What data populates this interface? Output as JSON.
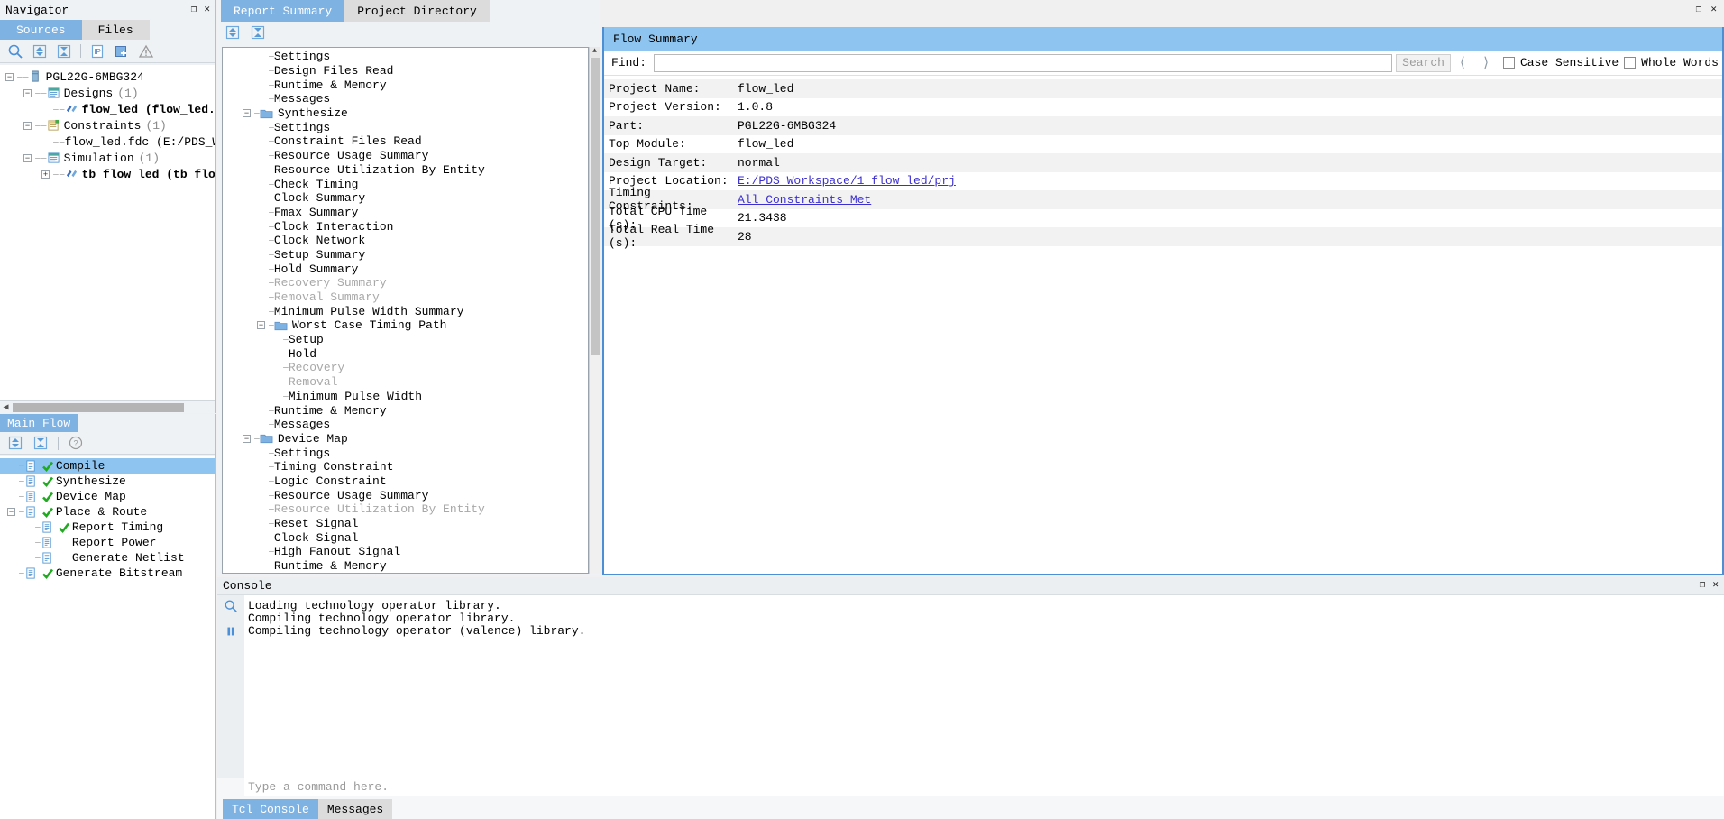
{
  "navigator": {
    "title": "Navigator",
    "tabs": [
      {
        "label": "Sources",
        "active": true
      },
      {
        "label": "Files",
        "active": false
      }
    ],
    "toolbar": [
      {
        "name": "search-icon"
      },
      {
        "name": "expand-all-icon"
      },
      {
        "name": "collapse-all-icon"
      },
      {
        "name": "ip-icon"
      },
      {
        "name": "add-file-icon"
      },
      {
        "name": "warning-icon"
      }
    ],
    "tree": [
      {
        "label": "PGL22G-6MBG324",
        "count": "",
        "indent": 0,
        "toggle": "minus",
        "icon": "device-icon"
      },
      {
        "label": "Designs",
        "count": "(1)",
        "indent": 1,
        "toggle": "minus",
        "icon": "folder-doc-icon"
      },
      {
        "label": "flow_led (flow_led.v)",
        "count": "",
        "indent": 2,
        "toggle": "none",
        "icon": "verilog-icon",
        "bold": true
      },
      {
        "label": "Constraints",
        "count": "(1)",
        "indent": 1,
        "toggle": "minus",
        "icon": "constraint-icon"
      },
      {
        "label": "flow_led.fdc (E:/PDS_Wo:",
        "count": "",
        "indent": 2,
        "toggle": "none",
        "icon": "none"
      },
      {
        "label": "Simulation",
        "count": "(1)",
        "indent": 1,
        "toggle": "minus",
        "icon": "folder-doc-icon"
      },
      {
        "label": "tb_flow_led (tb_flow_",
        "count": "",
        "indent": 2,
        "toggle": "plus",
        "icon": "verilog-icon",
        "bold": true
      }
    ]
  },
  "main_flow": {
    "tab_label": "Main_Flow",
    "toolbar": [
      {
        "name": "expand-all-icon"
      },
      {
        "name": "collapse-all-icon"
      },
      {
        "name": "help-icon"
      }
    ],
    "items": [
      {
        "label": "Compile",
        "done": true,
        "indent": 0,
        "toggle": "none",
        "selected": true
      },
      {
        "label": "Synthesize",
        "done": true,
        "indent": 0,
        "toggle": "none",
        "selected": false
      },
      {
        "label": "Device Map",
        "done": true,
        "indent": 0,
        "toggle": "none",
        "selected": false
      },
      {
        "label": "Place & Route",
        "done": true,
        "indent": 0,
        "toggle": "minus",
        "selected": false
      },
      {
        "label": "Report Timing",
        "done": true,
        "indent": 1,
        "toggle": "none",
        "selected": false
      },
      {
        "label": "Report Power",
        "done": false,
        "indent": 1,
        "toggle": "none",
        "selected": false
      },
      {
        "label": "Generate Netlist",
        "done": false,
        "indent": 1,
        "toggle": "none",
        "selected": false
      },
      {
        "label": "Generate Bitstream",
        "done": true,
        "indent": 0,
        "toggle": "none",
        "selected": false
      }
    ]
  },
  "center": {
    "tabs": [
      {
        "label": "Report Summary",
        "active": true
      },
      {
        "label": "Project Directory",
        "active": false
      }
    ],
    "toolbar": [
      {
        "name": "expand-all-icon"
      },
      {
        "name": "collapse-all-icon"
      }
    ],
    "report_tree": [
      {
        "label": "Settings",
        "indent": 2,
        "toggle": "none",
        "folder": false,
        "dim": false
      },
      {
        "label": "Design Files Read",
        "indent": 2,
        "toggle": "none",
        "folder": false,
        "dim": false
      },
      {
        "label": "Runtime & Memory",
        "indent": 2,
        "toggle": "none",
        "folder": false,
        "dim": false
      },
      {
        "label": "Messages",
        "indent": 2,
        "toggle": "none",
        "folder": false,
        "dim": false
      },
      {
        "label": "Synthesize",
        "indent": 1,
        "toggle": "minus",
        "folder": true,
        "dim": false
      },
      {
        "label": "Settings",
        "indent": 2,
        "toggle": "none",
        "folder": false,
        "dim": false
      },
      {
        "label": "Constraint Files Read",
        "indent": 2,
        "toggle": "none",
        "folder": false,
        "dim": false
      },
      {
        "label": "Resource Usage Summary",
        "indent": 2,
        "toggle": "none",
        "folder": false,
        "dim": false
      },
      {
        "label": "Resource Utilization By Entity",
        "indent": 2,
        "toggle": "none",
        "folder": false,
        "dim": false
      },
      {
        "label": "Check Timing",
        "indent": 2,
        "toggle": "none",
        "folder": false,
        "dim": false
      },
      {
        "label": "Clock Summary",
        "indent": 2,
        "toggle": "none",
        "folder": false,
        "dim": false
      },
      {
        "label": "Fmax Summary",
        "indent": 2,
        "toggle": "none",
        "folder": false,
        "dim": false
      },
      {
        "label": "Clock Interaction",
        "indent": 2,
        "toggle": "none",
        "folder": false,
        "dim": false
      },
      {
        "label": "Clock Network",
        "indent": 2,
        "toggle": "none",
        "folder": false,
        "dim": false
      },
      {
        "label": "Setup Summary",
        "indent": 2,
        "toggle": "none",
        "folder": false,
        "dim": false
      },
      {
        "label": "Hold Summary",
        "indent": 2,
        "toggle": "none",
        "folder": false,
        "dim": false
      },
      {
        "label": "Recovery Summary",
        "indent": 2,
        "toggle": "none",
        "folder": false,
        "dim": true
      },
      {
        "label": "Removal Summary",
        "indent": 2,
        "toggle": "none",
        "folder": false,
        "dim": true
      },
      {
        "label": "Minimum Pulse Width Summary",
        "indent": 2,
        "toggle": "none",
        "folder": false,
        "dim": false
      },
      {
        "label": "Worst Case Timing Path",
        "indent": 2,
        "toggle": "minus",
        "folder": true,
        "dim": false
      },
      {
        "label": "Setup",
        "indent": 3,
        "toggle": "none",
        "folder": false,
        "dim": false
      },
      {
        "label": "Hold",
        "indent": 3,
        "toggle": "none",
        "folder": false,
        "dim": false
      },
      {
        "label": "Recovery",
        "indent": 3,
        "toggle": "none",
        "folder": false,
        "dim": true
      },
      {
        "label": "Removal",
        "indent": 3,
        "toggle": "none",
        "folder": false,
        "dim": true
      },
      {
        "label": "Minimum Pulse Width",
        "indent": 3,
        "toggle": "none",
        "folder": false,
        "dim": false
      },
      {
        "label": "Runtime & Memory",
        "indent": 2,
        "toggle": "none",
        "folder": false,
        "dim": false
      },
      {
        "label": "Messages",
        "indent": 2,
        "toggle": "none",
        "folder": false,
        "dim": false
      },
      {
        "label": "Device Map",
        "indent": 1,
        "toggle": "minus",
        "folder": true,
        "dim": false
      },
      {
        "label": "Settings",
        "indent": 2,
        "toggle": "none",
        "folder": false,
        "dim": false
      },
      {
        "label": "Timing Constraint",
        "indent": 2,
        "toggle": "none",
        "folder": false,
        "dim": false
      },
      {
        "label": "Logic Constraint",
        "indent": 2,
        "toggle": "none",
        "folder": false,
        "dim": false
      },
      {
        "label": "Resource Usage Summary",
        "indent": 2,
        "toggle": "none",
        "folder": false,
        "dim": false
      },
      {
        "label": "Resource Utilization By Entity",
        "indent": 2,
        "toggle": "none",
        "folder": false,
        "dim": true
      },
      {
        "label": "Reset Signal",
        "indent": 2,
        "toggle": "none",
        "folder": false,
        "dim": false
      },
      {
        "label": "Clock Signal",
        "indent": 2,
        "toggle": "none",
        "folder": false,
        "dim": false
      },
      {
        "label": "High Fanout Signal",
        "indent": 2,
        "toggle": "none",
        "folder": false,
        "dim": false
      },
      {
        "label": "Runtime & Memory",
        "indent": 2,
        "toggle": "none",
        "folder": false,
        "dim": false
      }
    ]
  },
  "document": {
    "title": "Flow Summary",
    "find": {
      "label": "Find:",
      "value": "",
      "placeholder": "",
      "search_button": "Search",
      "prev_icon": "chevron-left-icon",
      "next_icon": "chevron-right-icon",
      "case_sensitive_label": "Case Sensitive",
      "whole_words_label": "Whole Words",
      "case_sensitive_checked": false,
      "whole_words_checked": false
    },
    "summary_rows": [
      {
        "key": "Project Name:",
        "value": "flow_led",
        "link": false
      },
      {
        "key": "Project Version:",
        "value": "1.0.8",
        "link": false
      },
      {
        "key": "Part:",
        "value": "PGL22G-6MBG324",
        "link": false
      },
      {
        "key": "Top Module:",
        "value": "flow_led",
        "link": false
      },
      {
        "key": "Design Target:",
        "value": "normal",
        "link": false
      },
      {
        "key": "Project Location:",
        "value": "E:/PDS_Workspace/1_flow_led/prj",
        "link": true
      },
      {
        "key": "Timing Constraints:",
        "value": "All Constraints Met",
        "link": true
      },
      {
        "key": "Total CPU Time (s):",
        "value": "21.3438",
        "link": false
      },
      {
        "key": "Total Real Time (s):",
        "value": "28",
        "link": false
      }
    ]
  },
  "console": {
    "title": "Console",
    "gutter_icons": [
      {
        "name": "search-icon"
      },
      {
        "name": "pause-icon"
      }
    ],
    "lines": [
      "Loading technology operator library.",
      "Compiling technology operator library.",
      "Compiling technology operator (valence) library."
    ],
    "input_placeholder": "Type a command here.",
    "tabs": [
      {
        "label": "Tcl Console",
        "active": true
      },
      {
        "label": "Messages",
        "active": false
      }
    ]
  },
  "window_controls": {
    "navigator_float": "float-icon",
    "navigator_close": "close-icon",
    "center_float": "float-icon",
    "center_close": "close-icon",
    "console_float": "float-icon",
    "console_close": "close-icon"
  },
  "colors": {
    "accent": "#7eb2e3",
    "doc_border": "#4d8fd4",
    "link": "#3b2fd0",
    "check": "#22a022",
    "panel_bg": "#eff2f5"
  }
}
